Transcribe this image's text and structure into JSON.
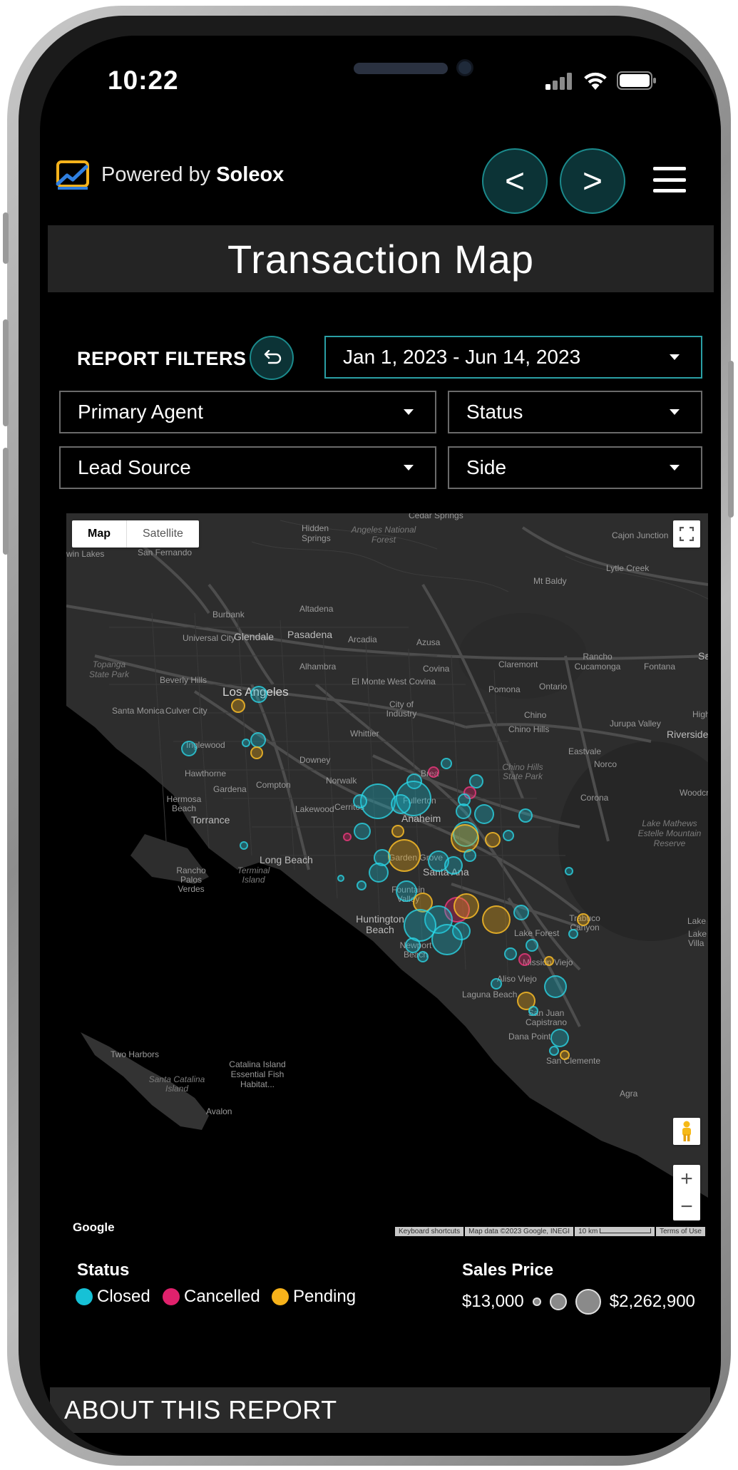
{
  "status_bar": {
    "time": "10:22"
  },
  "header": {
    "powered_by": "Powered by",
    "brand": "Soleox",
    "prev_label": "<",
    "next_label": ">",
    "menu_icon": "hamburger-icon"
  },
  "page_title": "Transaction Map",
  "filters": {
    "label": "REPORT FILTERS",
    "reset_icon": "undo-icon",
    "date_range": "Jan 1, 2023 - Jun 14, 2023",
    "primary_agent": "Primary Agent",
    "status": "Status",
    "lead_source": "Lead Source",
    "side": "Side"
  },
  "map": {
    "type_map": "Map",
    "type_satellite": "Satellite",
    "google": "Google",
    "footer": [
      "Keyboard shortcuts",
      "Map data ©2023 Google, INEGI",
      "10 km",
      "Terms of Use"
    ],
    "labels": {
      "cedar_springs": "Cedar Springs",
      "win_lakes": "win Lakes",
      "san_fernando": "San Fernando",
      "hidden_springs": "Hidden Springs",
      "angeles_nf": "Angeles National Forest",
      "cajon_junction": "Cajon Junction",
      "lytle_creek": "Lytle Creek",
      "mt_baldy": "Mt Baldy",
      "burbank": "Burbank",
      "altadena": "Altadena",
      "universal_city": "Universal City",
      "glendale": "Glendale",
      "pasadena": "Pasadena",
      "arcadia": "Arcadia",
      "azusa": "Azusa",
      "topanga": "Topanga State Park",
      "alhambra": "Alhambra",
      "covina": "Covina",
      "claremont": "Claremont",
      "rancho_cucamonga": "Rancho Cucamonga",
      "fontana": "Fontana",
      "beverly_hills": "Beverly Hills",
      "el_monte": "El Monte",
      "west_covina": "West Covina",
      "pomona": "Pomona",
      "ontario": "Ontario",
      "los_angeles": "Los Angeles",
      "santa_monica": "Santa Monica",
      "culver_city": "Culver City",
      "city_of_industry": "City of Industry",
      "chino": "Chino",
      "chino_hills": "Chino Hills",
      "jurupa_valley": "Jurupa Valley",
      "riverside": "Riverside",
      "inglewood": "Inglewood",
      "whittier": "Whittier",
      "eastvale": "Eastvale",
      "downey": "Downey",
      "hawthorne": "Hawthorne",
      "brea": "Brea",
      "chino_hills_sp": "Chino Hills State Park",
      "norco": "Norco",
      "gardena": "Gardena",
      "compton": "Compton",
      "norwalk": "Norwalk",
      "fullerton": "Fullerton",
      "corona": "Corona",
      "woodcrest": "Woodcre",
      "hermosa_beach": "Hermosa Beach",
      "lakewood": "Lakewood",
      "cerritos": "Cerritos",
      "anaheim": "Anaheim",
      "torrance": "Torrance",
      "lake_mathews": "Lake Mathews Estelle Mountain Reserve",
      "garden_grove": "Garden Grove",
      "long_beach": "Long Beach",
      "rancho_palos_verdes": "Rancho Palos Verdes",
      "terminal_island": "Terminal Island",
      "santa_ana": "Santa Ana",
      "fountain_valley": "Fountain Valley",
      "huntington_beach": "Huntington Beach",
      "trabuco_canyon": "Trabuco Canyon",
      "lake_forest": "Lake Forest",
      "newport_beach": "Newport Beach",
      "mission_viejo": "Mission Viejo",
      "aliso_viejo": "Aliso Viejo",
      "laguna_beach": "Laguna Beach",
      "san_juan_capistrano": "San Juan Capistrano",
      "dana_point": "Dana Point",
      "san_clemente": "San Clemente",
      "two_harbors": "Two Harbors",
      "catalina_island": "Catalina Island Essential Fish Habitat...",
      "santa_catalina": "Santa Catalina Island",
      "avalon": "Avalon",
      "agra": "Agra",
      "sa": "Sa",
      "high": "High",
      "lake": "Lake",
      "lake_villa": "Lake Villa"
    }
  },
  "legend": {
    "status_title": "Status",
    "closed": "Closed",
    "cancelled": "Cancelled",
    "pending": "Pending",
    "price_title": "Sales Price",
    "min_price": "$13,000",
    "max_price": "$2,262,900",
    "colors": {
      "closed": "#16c1d6",
      "cancelled": "#e0216c",
      "pending": "#f7b21a"
    }
  },
  "about": "ABOUT THIS REPORT"
}
